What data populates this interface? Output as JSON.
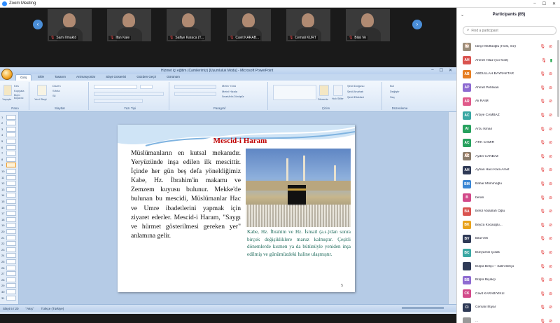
{
  "zoom": {
    "title": "Zoom Meeting",
    "controls": {
      "minimize": "–",
      "maximize": "☐",
      "close": "✕"
    }
  },
  "gallery": {
    "prev_icon": "‹",
    "next_icon": "›",
    "mic_icon": "🎙",
    "tiles": [
      {
        "name": "Sami Ilmaktö"
      },
      {
        "name": "Ifan Kale"
      },
      {
        "name": "Safiye Karaca (T..."
      },
      {
        "name": "Cavit KARAB..."
      },
      {
        "name": "Cemali KURT"
      },
      {
        "name": "Bilal Ve"
      }
    ]
  },
  "powerpoint": {
    "window_title": "Hizmet içi eğitim (Camilerimiz) [Uyumluluk Modu] - Microsoft PowerPoint",
    "window_controls": {
      "minimize": "–",
      "maximize": "☐",
      "close": "✕"
    },
    "tabs": [
      "Giriş",
      "Ekle",
      "Tasarım",
      "Animasyonlar",
      "Slayt Gösterisi",
      "Gözden Geçir",
      "Görünüm"
    ],
    "active_tab": "Giriş",
    "groups": [
      "Pano",
      "Slaytlar",
      "Yazı Tipi",
      "Paragraf",
      "Çizim",
      "Düzenleme"
    ],
    "ribbon_text": {
      "paste": "Yapıştır",
      "cut": "Kes",
      "copy": "Kopyala",
      "format_painter": "Biçim Boyacısı",
      "new_slide": "Yeni Slayt",
      "layout": "Düzen",
      "reset": "Sıfırla",
      "delete": "Sil",
      "text_direction": "Metin Yönü",
      "align_text": "Metni Hizala",
      "smartart": "SmartArt'a Dönüştür",
      "arrange": "Düzenle",
      "quick_styles": "Hızlı Stiller",
      "shape_fill": "Şekil Dolgusu",
      "shape_outline": "Şekil Anahatı",
      "shape_effects": "Şekil Efektleri",
      "find": "Bul",
      "replace": "Değiştir",
      "select": "Seç"
    },
    "thumbnails": [
      "1",
      "2",
      "3",
      "4",
      "5",
      "6",
      "7",
      "8",
      "9",
      "10",
      "11",
      "12",
      "13",
      "14",
      "15",
      "16",
      "17",
      "18",
      "19",
      "20",
      "21",
      "22",
      "23",
      "24",
      "25",
      "26",
      "27",
      "28",
      "29",
      "30",
      "31"
    ],
    "active_thumb": 9,
    "slide": {
      "title": "Mescid-i Haram",
      "body": "Müslümanların en kutsal mekanıdır. Yeryüzünde inşa edilen ilk mescittir. İçinde her gün beş defa yöneldiğimiz Kabe, Hz. İbrahim'in makamı ve Zemzem kuyusu bulunur. Mekke'de bulunan bu mescidi, Müslümanlar Hac ve Umre ibadetlerini yapmak için ziyaret ederler. Mescid-i Haram, \"Saygı ve hürmet gösterilmesi gereken yer\" anlamına gelir.",
      "caption": "Kabe, Hz. İbrahim ve Hz. İsmail (a.s.)'dan sonra birçok değişikliklere maruz kalmıştır. Çeşitli dönemlerde kısmen ya da bütünüyle yeniden inşa edilmiş ve günümüzdeki haline ulaşmıştır.",
      "page_number": "5"
    },
    "status": {
      "slide_info": "Slayt 5 / 20",
      "theme": "\"Akış\"",
      "language": "Türkçe (Türkiye)"
    }
  },
  "participants": {
    "title": "Participants (85)",
    "search_placeholder": "Find a participant",
    "list": [
      {
        "initials": "İM",
        "name": "İdeçe Müftüoğlu (Host, me)",
        "color": "#9b8d7a",
        "photo": true,
        "cam": "off"
      },
      {
        "initials": "AH",
        "name": "Ahmet Hilaz (Co-host)",
        "color": "#d9534f",
        "cam": "on"
      },
      {
        "initials": "AB",
        "name": "ABDULLAH BAYRAKTAR",
        "color": "#e67e22",
        "cam": "off"
      },
      {
        "initials": "AP",
        "name": "Ahmet Pehlivan",
        "color": "#8e6bd1",
        "cam": "off"
      },
      {
        "initials": "AR",
        "name": "Ali RAIM",
        "color": "#e05a8a",
        "cam": "off"
      },
      {
        "initials": "AC",
        "name": "Arziye CAMBAZ",
        "color": "#3aa7a3",
        "cam": "off"
      },
      {
        "initials": "AI",
        "name": "Arzu İsmail",
        "color": "#27a15e",
        "cam": "off"
      },
      {
        "initials": "AC",
        "name": "ATIK CAMIR",
        "color": "#27a15e",
        "cam": "off"
      },
      {
        "initials": "AC",
        "name": "Aydın CANBAZ",
        "color": "#8a7b6a",
        "photo": true,
        "cam": "off"
      },
      {
        "initials": "AH",
        "name": "Ayhan Hacı Kara Amet",
        "color": "#2f3a56",
        "cam": "off"
      },
      {
        "initials": "BM",
        "name": "Bahar Mümmoğlu",
        "color": "#3a86d4",
        "cam": "off"
      },
      {
        "initials": "B",
        "name": "beran",
        "color": "#d24a8a",
        "cam": "off"
      },
      {
        "initials": "BA",
        "name": "Betül Abdullah Oğlu",
        "color": "#d9534f",
        "cam": "off"
      },
      {
        "initials": "BK",
        "name": "Beyza Kocaoğlu...",
        "color": "#e8a21c",
        "cam": "off"
      },
      {
        "initials": "BV",
        "name": "Bilal Veli",
        "color": "#2f3a56",
        "cam": "off"
      },
      {
        "initials": "BC",
        "name": "Bünyamin Çolak",
        "color": "#3aa7a3",
        "cam": "off"
      },
      {
        "initials": "",
        "name": "Büşra Belço – Salih Belço",
        "color": "#2f3a56",
        "cam": "off"
      },
      {
        "initials": "BB",
        "name": "Büşra Biçakçı",
        "color": "#8e6bd1",
        "cam": "off"
      },
      {
        "initials": "CK",
        "name": "Cavit KARABIYIKLI",
        "color": "#d24a8a",
        "cam": "off"
      },
      {
        "initials": "Ci",
        "name": "Cemali İhtiyar",
        "color": "#2f3a56",
        "cam": "off"
      },
      {
        "initials": "",
        "name": "...",
        "color": "#999999",
        "cam": "off"
      }
    ],
    "icons": {
      "mic_off": "🎙",
      "cam_off": "⊘",
      "cam_on": "▮"
    }
  }
}
